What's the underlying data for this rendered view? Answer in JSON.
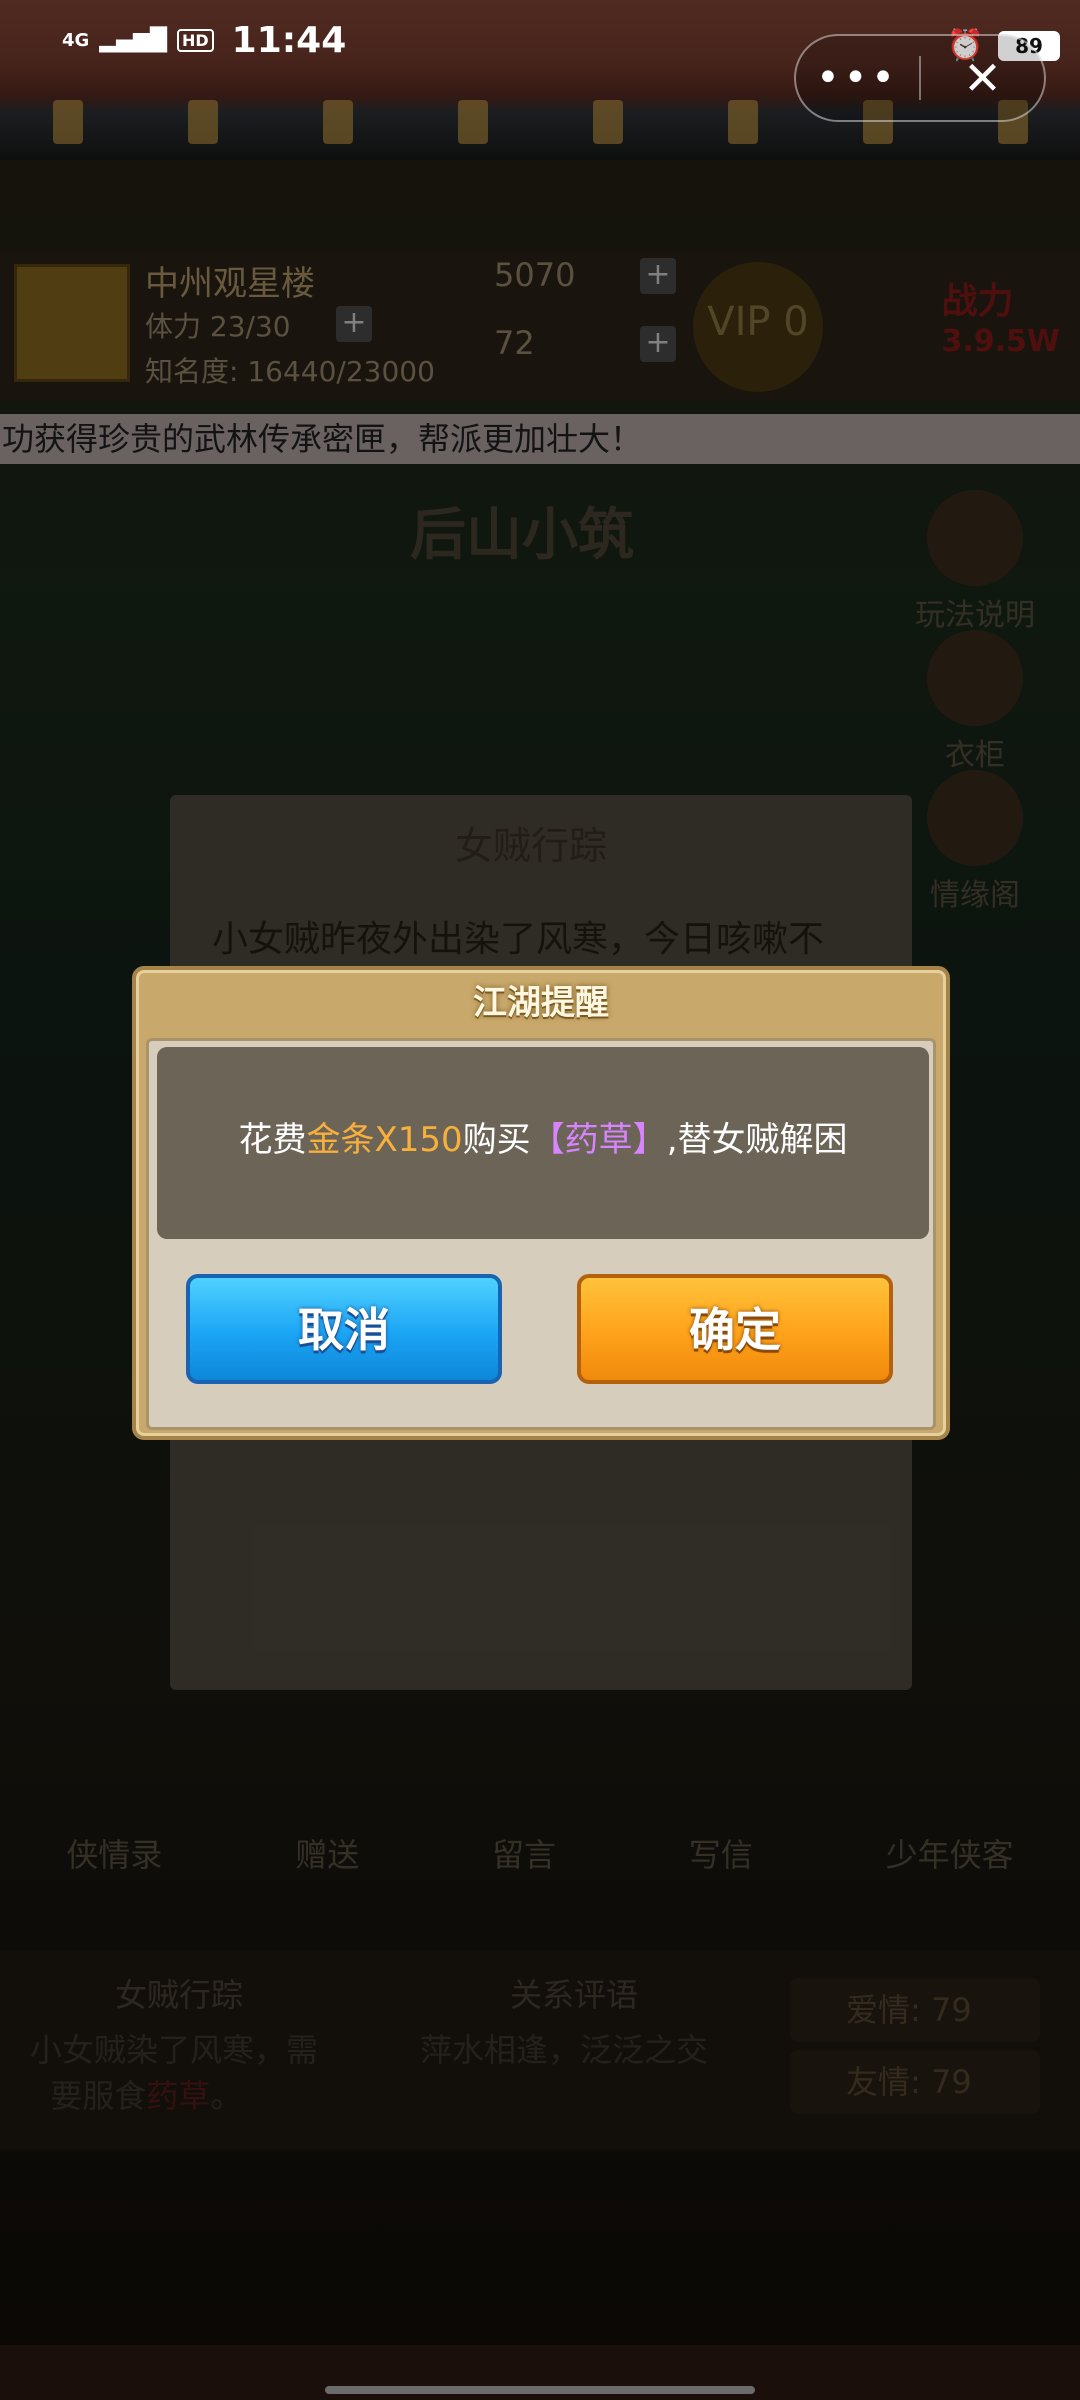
{
  "status_bar": {
    "network": "4G",
    "hd": "HD",
    "time": "11:44",
    "battery": "89"
  },
  "capsule": {
    "more_icon": "more-dots",
    "close_icon": "close-x"
  },
  "hud": {
    "location": "中州观星楼",
    "stamina": "体力 23/30",
    "fame": "知名度: 16440/23000",
    "silver": "5070",
    "gold": "72",
    "vip": "VIP 0",
    "power_label": "战力",
    "power_value": "3.9.5W"
  },
  "marquee": "功获得珍贵的武林传承密匣，帮派更加壮大！",
  "scene": {
    "title": "后山小筑",
    "side_menu": [
      "玩法说明",
      "衣柜",
      "情缘阁"
    ]
  },
  "event_panel": {
    "title": "女贼行踪",
    "text": "小女贼昨夜外出染了风寒，今日咳嗽不"
  },
  "bottom_tabs": [
    "侠情录",
    "赠送",
    "留言",
    "写信",
    "少年侠客"
  ],
  "info": {
    "left_title": "女贼行踪",
    "left_text_a": "小女贼染了风寒，需",
    "left_text_b": "要服食",
    "left_text_item": "药草",
    "left_text_end": "。",
    "mid_title": "关系评语",
    "mid_text": "萍水相逢，泛泛之交",
    "love_label": "爱情:",
    "love_value": "79",
    "friend_label": "友情:",
    "friend_value": "79"
  },
  "dialog": {
    "title": "江湖提醒",
    "msg_prefix": "花费",
    "msg_gold": "金条X150",
    "msg_mid": "购买",
    "msg_item": "【药草】",
    "msg_suffix": ",替女贼解困",
    "cancel_label": "取消",
    "confirm_label": "确定"
  }
}
